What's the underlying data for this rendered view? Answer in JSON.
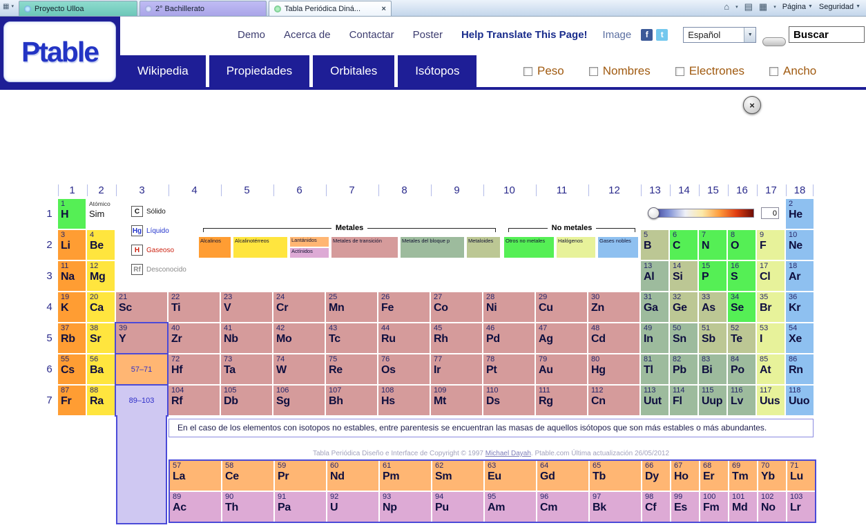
{
  "browser": {
    "tabs": [
      {
        "title": "Proyecto Ulloa"
      },
      {
        "title": "2° Bachillerato"
      },
      {
        "title": "Tabla Periódica Diná...",
        "active": true
      }
    ],
    "commands": [
      {
        "label": "Página"
      },
      {
        "label": "Seguridad"
      }
    ]
  },
  "icons": {
    "close": "×",
    "caret_down": "▼",
    "home": "⌂",
    "feed": "▤",
    "print": "▦",
    "grid": "▦",
    "facebook": "f",
    "twitter": "t"
  },
  "header": {
    "logo": "Ptable",
    "nav": [
      {
        "label": "Demo"
      },
      {
        "label": "Acerca de"
      },
      {
        "label": "Contactar"
      },
      {
        "label": "Poster"
      }
    ],
    "help_link": "Help Translate This Page!",
    "image_link": "Image",
    "language": {
      "selected": "Español"
    },
    "search": {
      "value": "Buscar"
    },
    "tabs": [
      {
        "label": "Wikipedia"
      },
      {
        "label": "Propiedades"
      },
      {
        "label": "Orbitales"
      },
      {
        "label": "Isótopos",
        "active": true
      }
    ],
    "toggles": [
      {
        "label": "Peso",
        "checked": false
      },
      {
        "label": "Nombres",
        "checked": false
      },
      {
        "label": "Electrones",
        "checked": false
      },
      {
        "label": "Ancho",
        "checked": false
      }
    ]
  },
  "content": {
    "close_button": "×"
  },
  "table": {
    "groups": [
      1,
      2,
      3,
      4,
      5,
      6,
      7,
      8,
      9,
      10,
      11,
      12,
      13,
      14,
      15,
      16,
      17,
      18
    ],
    "periods": [
      1,
      2,
      3,
      4,
      5,
      6,
      7
    ],
    "key": {
      "top": "Atómico",
      "symbol": "Sim"
    },
    "states": [
      {
        "symbol": "C",
        "label": "Sólido",
        "color": "#111111"
      },
      {
        "symbol": "Hg",
        "label": "Líquido",
        "color": "#2233cc"
      },
      {
        "symbol": "H",
        "label": "Gaseoso",
        "color": "#cc2211"
      },
      {
        "symbol": "Rf",
        "label": "Desconocido",
        "color": "#8a8a8a"
      }
    ],
    "headers": {
      "metals": "Metales",
      "nonmetals": "No metales"
    },
    "categories": [
      {
        "label": "Alcalinos",
        "cat": "alk"
      },
      {
        "label": "Alcalinotérreos",
        "cat": "ae"
      },
      {
        "label": "Lantánidos",
        "cat": "la"
      },
      {
        "label": "Actínidos",
        "cat": "ac"
      },
      {
        "label": "Metales de transición",
        "cat": "tm"
      },
      {
        "label": "Metales del bloque p",
        "cat": "ptm"
      },
      {
        "label": "Metaloides",
        "cat": "mtl"
      },
      {
        "label": "Otros no metales",
        "cat": "nm"
      },
      {
        "label": "Halógenos",
        "cat": "hal"
      },
      {
        "label": "Gases nobles",
        "cat": "ng"
      }
    ],
    "temperature": "0",
    "elements": [
      [
        1,
        "H",
        1,
        1,
        "nm"
      ],
      [
        2,
        "He",
        18,
        1,
        "ng"
      ],
      [
        3,
        "Li",
        1,
        2,
        "alk"
      ],
      [
        4,
        "Be",
        2,
        2,
        "ae"
      ],
      [
        5,
        "B",
        13,
        2,
        "mtl"
      ],
      [
        6,
        "C",
        14,
        2,
        "nm"
      ],
      [
        7,
        "N",
        15,
        2,
        "nm"
      ],
      [
        8,
        "O",
        16,
        2,
        "nm"
      ],
      [
        9,
        "F",
        17,
        2,
        "hal"
      ],
      [
        10,
        "Ne",
        18,
        2,
        "ng"
      ],
      [
        11,
        "Na",
        1,
        3,
        "alk"
      ],
      [
        12,
        "Mg",
        2,
        3,
        "ae"
      ],
      [
        13,
        "Al",
        13,
        3,
        "ptm"
      ],
      [
        14,
        "Si",
        14,
        3,
        "mtl"
      ],
      [
        15,
        "P",
        15,
        3,
        "nm"
      ],
      [
        16,
        "S",
        16,
        3,
        "nm"
      ],
      [
        17,
        "Cl",
        17,
        3,
        "hal"
      ],
      [
        18,
        "Ar",
        18,
        3,
        "ng"
      ],
      [
        19,
        "K",
        1,
        4,
        "alk"
      ],
      [
        20,
        "Ca",
        2,
        4,
        "ae"
      ],
      [
        21,
        "Sc",
        3,
        4,
        "tm"
      ],
      [
        22,
        "Ti",
        4,
        4,
        "tm"
      ],
      [
        23,
        "V",
        5,
        4,
        "tm"
      ],
      [
        24,
        "Cr",
        6,
        4,
        "tm"
      ],
      [
        25,
        "Mn",
        7,
        4,
        "tm"
      ],
      [
        26,
        "Fe",
        8,
        4,
        "tm"
      ],
      [
        27,
        "Co",
        9,
        4,
        "tm"
      ],
      [
        28,
        "Ni",
        10,
        4,
        "tm"
      ],
      [
        29,
        "Cu",
        11,
        4,
        "tm"
      ],
      [
        30,
        "Zn",
        12,
        4,
        "tm"
      ],
      [
        31,
        "Ga",
        13,
        4,
        "ptm"
      ],
      [
        32,
        "Ge",
        14,
        4,
        "mtl"
      ],
      [
        33,
        "As",
        15,
        4,
        "mtl"
      ],
      [
        34,
        "Se",
        16,
        4,
        "nm"
      ],
      [
        35,
        "Br",
        17,
        4,
        "hal"
      ],
      [
        36,
        "Kr",
        18,
        4,
        "ng"
      ],
      [
        37,
        "Rb",
        1,
        5,
        "alk"
      ],
      [
        38,
        "Sr",
        2,
        5,
        "ae"
      ],
      [
        39,
        "Y",
        3,
        5,
        "tm"
      ],
      [
        40,
        "Zr",
        4,
        5,
        "tm"
      ],
      [
        41,
        "Nb",
        5,
        5,
        "tm"
      ],
      [
        42,
        "Mo",
        6,
        5,
        "tm"
      ],
      [
        43,
        "Tc",
        7,
        5,
        "tm"
      ],
      [
        44,
        "Ru",
        8,
        5,
        "tm"
      ],
      [
        45,
        "Rh",
        9,
        5,
        "tm"
      ],
      [
        46,
        "Pd",
        10,
        5,
        "tm"
      ],
      [
        47,
        "Ag",
        11,
        5,
        "tm"
      ],
      [
        48,
        "Cd",
        12,
        5,
        "tm"
      ],
      [
        49,
        "In",
        13,
        5,
        "ptm"
      ],
      [
        50,
        "Sn",
        14,
        5,
        "ptm"
      ],
      [
        51,
        "Sb",
        15,
        5,
        "mtl"
      ],
      [
        52,
        "Te",
        16,
        5,
        "mtl"
      ],
      [
        53,
        "I",
        17,
        5,
        "hal"
      ],
      [
        54,
        "Xe",
        18,
        5,
        "ng"
      ],
      [
        55,
        "Cs",
        1,
        6,
        "alk"
      ],
      [
        56,
        "Ba",
        2,
        6,
        "ae"
      ],
      [
        72,
        "Hf",
        4,
        6,
        "tm"
      ],
      [
        73,
        "Ta",
        5,
        6,
        "tm"
      ],
      [
        74,
        "W",
        6,
        6,
        "tm"
      ],
      [
        75,
        "Re",
        7,
        6,
        "tm"
      ],
      [
        76,
        "Os",
        8,
        6,
        "tm"
      ],
      [
        77,
        "Ir",
        9,
        6,
        "tm"
      ],
      [
        78,
        "Pt",
        10,
        6,
        "tm"
      ],
      [
        79,
        "Au",
        11,
        6,
        "tm"
      ],
      [
        80,
        "Hg",
        12,
        6,
        "tm"
      ],
      [
        81,
        "Tl",
        13,
        6,
        "ptm"
      ],
      [
        82,
        "Pb",
        14,
        6,
        "ptm"
      ],
      [
        83,
        "Bi",
        15,
        6,
        "ptm"
      ],
      [
        84,
        "Po",
        16,
        6,
        "ptm"
      ],
      [
        85,
        "At",
        17,
        6,
        "hal"
      ],
      [
        86,
        "Rn",
        18,
        6,
        "ng"
      ],
      [
        87,
        "Fr",
        1,
        7,
        "alk"
      ],
      [
        88,
        "Ra",
        2,
        7,
        "ae"
      ],
      [
        104,
        "Rf",
        4,
        7,
        "tm"
      ],
      [
        105,
        "Db",
        5,
        7,
        "tm"
      ],
      [
        106,
        "Sg",
        6,
        7,
        "tm"
      ],
      [
        107,
        "Bh",
        7,
        7,
        "tm"
      ],
      [
        108,
        "Hs",
        8,
        7,
        "tm"
      ],
      [
        109,
        "Mt",
        9,
        7,
        "tm"
      ],
      [
        110,
        "Ds",
        10,
        7,
        "tm"
      ],
      [
        111,
        "Rg",
        11,
        7,
        "tm"
      ],
      [
        112,
        "Cn",
        12,
        7,
        "tm"
      ],
      [
        113,
        "Uut",
        13,
        7,
        "ptm"
      ],
      [
        114,
        "Fl",
        14,
        7,
        "ptm"
      ],
      [
        115,
        "Uup",
        15,
        7,
        "ptm"
      ],
      [
        116,
        "Lv",
        16,
        7,
        "ptm"
      ],
      [
        117,
        "Uus",
        17,
        7,
        "hal"
      ],
      [
        118,
        "Uuo",
        18,
        7,
        "ng"
      ]
    ],
    "placeholders": [
      {
        "label": "57–71",
        "row": 6,
        "bg": "#ffb673"
      },
      {
        "label": "89–103",
        "row": 7,
        "bg": "#cfc8f2"
      }
    ],
    "fblock": {
      "lanthanides": [
        [
          57,
          "La"
        ],
        [
          58,
          "Ce"
        ],
        [
          59,
          "Pr"
        ],
        [
          60,
          "Nd"
        ],
        [
          61,
          "Pm"
        ],
        [
          62,
          "Sm"
        ],
        [
          63,
          "Eu"
        ],
        [
          64,
          "Gd"
        ],
        [
          65,
          "Tb"
        ],
        [
          66,
          "Dy"
        ],
        [
          67,
          "Ho"
        ],
        [
          68,
          "Er"
        ],
        [
          69,
          "Tm"
        ],
        [
          70,
          "Yb"
        ],
        [
          71,
          "Lu"
        ]
      ],
      "actinides": [
        [
          89,
          "Ac"
        ],
        [
          90,
          "Th"
        ],
        [
          91,
          "Pa"
        ],
        [
          92,
          "U"
        ],
        [
          93,
          "Np"
        ],
        [
          94,
          "Pu"
        ],
        [
          95,
          "Am"
        ],
        [
          96,
          "Cm"
        ],
        [
          97,
          "Bk"
        ],
        [
          98,
          "Cf"
        ],
        [
          99,
          "Es"
        ],
        [
          100,
          "Fm"
        ],
        [
          101,
          "Md"
        ],
        [
          102,
          "No"
        ],
        [
          103,
          "Lr"
        ]
      ]
    },
    "note": "En el caso de los elementos con isotopos no estables, entre parentesis se encuentran las masas de aquellos isótopos que son más estables o más abundantes.",
    "footer": {
      "before": "Tabla Periódica Diseño e Interface de Copyright © 1997 ",
      "link": "Michael Dayah",
      "after": ". Ptable.com Última actualización 26/05/2012"
    }
  },
  "colors": {
    "alk": "#ff9d33",
    "ae": "#ffe53e",
    "tm": "#d59b9b",
    "la": "#ffb673",
    "ac": "#ddaad5",
    "ptm": "#9dbb9d",
    "mtl": "#bcc794",
    "nm": "#55ef55",
    "hal": "#e7f29a",
    "ng": "#8ec0f0",
    "accent_blue": "#1e1e96",
    "outline_blue": "#4a4ad8"
  }
}
